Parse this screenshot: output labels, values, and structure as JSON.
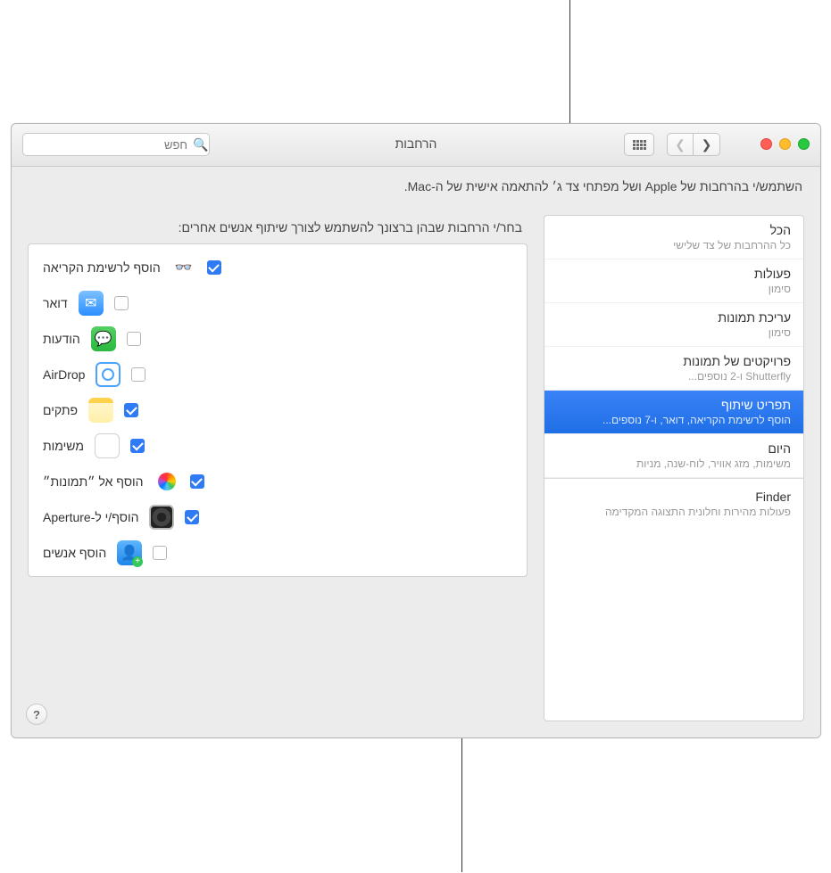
{
  "window": {
    "title": "הרחבות"
  },
  "search": {
    "placeholder": "חפש"
  },
  "intro": "השתמש/י בהרחבות של Apple ושל מפתחי צד ג׳ להתאמה אישית של ה-Mac.",
  "sidebar": {
    "items": [
      {
        "title": "הכל",
        "sub": "כל ההרחבות של צד שלישי"
      },
      {
        "title": "פעולות",
        "sub": "סימון"
      },
      {
        "title": "עריכת תמונות",
        "sub": "סימון"
      },
      {
        "title": "פרויקטים של תמונות",
        "sub": "Shutterfly ו-2 נוספים..."
      },
      {
        "title": "תפריט שיתוף",
        "sub": "הוסף לרשימת הקריאה, דואר, ו-7 נוספים..."
      },
      {
        "title": "היום",
        "sub": "משימות, מזג אוויר, לוח-שנה, מניות"
      },
      {
        "title": "Finder",
        "sub": "פעולות מהירות וחלונית התצוגה המקדימה"
      }
    ],
    "selected_index": 4
  },
  "pane": {
    "header": "בחר/י הרחבות שבהן ברצונך להשתמש לצורך שיתוף אנשים אחרים:",
    "rows": [
      {
        "label": "הוסף לרשימת הקריאה",
        "icon": "glasses",
        "checked": true
      },
      {
        "label": "דואר",
        "icon": "mail",
        "checked": false
      },
      {
        "label": "הודעות",
        "icon": "messages",
        "checked": false
      },
      {
        "label": "AirDrop",
        "icon": "airdrop",
        "checked": false
      },
      {
        "label": "פתקים",
        "icon": "notes",
        "checked": true
      },
      {
        "label": "משימות",
        "icon": "reminders",
        "checked": true
      },
      {
        "label": "הוסף אל ״תמונות״",
        "icon": "photos",
        "checked": true
      },
      {
        "label": "הוסף/י ל-Aperture",
        "icon": "aperture",
        "checked": true
      },
      {
        "label": "הוסף אנשים",
        "icon": "people",
        "checked": false
      }
    ]
  },
  "help_label": "?"
}
